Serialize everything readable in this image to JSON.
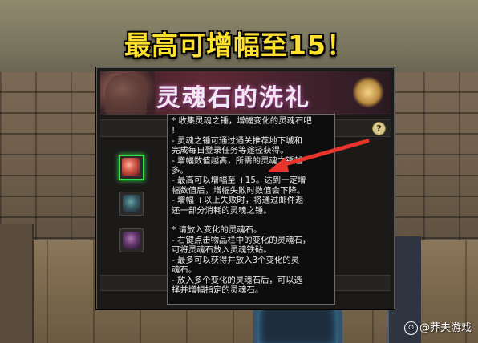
{
  "headline": "最高可增幅至15！",
  "window": {
    "title": "灵魂石的洗礼",
    "help_label": "?"
  },
  "slots": [
    {
      "state": "active",
      "gem_color": "#d45b4a"
    },
    {
      "state": "inactive",
      "gem_color": "#3d6e80"
    },
    {
      "state": "inactive",
      "gem_color": "#7a3c8c"
    }
  ],
  "tooltip": {
    "lines": [
      "* 收集灵魂之锤，增幅变化的灵魂石吧",
      "!",
      " - 灵魂之锤可通过通关推荐地下城和",
      "完成每日登录任务等途径获得。",
      " - 增幅数值越高，所需的灵魂之锤越",
      "多。",
      " - 最高可以增幅至 +15。达到一定增",
      "幅数值后，增幅失败时数值会下降。",
      " - 增幅 +以上失败时，将通过邮件返",
      "还一部分消耗的灵魂之锤。",
      "",
      " * 请放入变化的灵魂石。",
      " - 右键点击物品栏中的变化的灵魂石，",
      "可将灵魂石放入灵魂铁砧。",
      " - 最多可以获得并放入3个变化的灵",
      "魂石。",
      " - 放入多个变化的灵魂石后，可以选",
      "择并增幅指定的灵魂石。"
    ]
  },
  "watermark": {
    "text": "@莽夫游戏"
  },
  "colors": {
    "headline": "#ffe12e",
    "active_slot_border": "#35e04a",
    "arrow": "#e8342a"
  }
}
